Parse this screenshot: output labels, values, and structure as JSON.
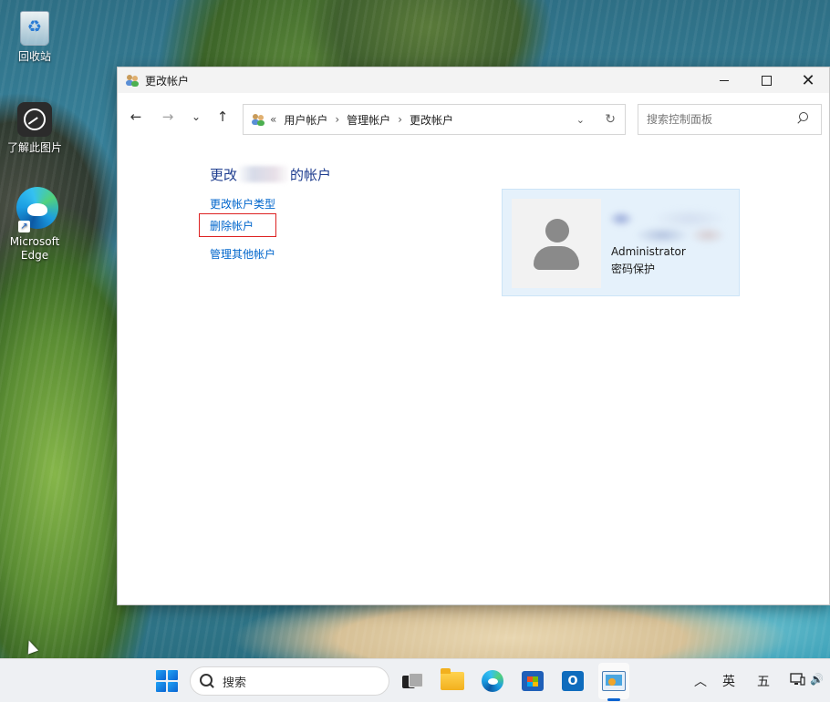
{
  "desktop": {
    "icons": [
      {
        "label": "回收站",
        "icon": "recycle-bin-icon"
      },
      {
        "label": "了解此图片",
        "icon": "learn-about-picture-icon"
      },
      {
        "label": "Microsoft Edge",
        "icon": "edge-icon"
      }
    ]
  },
  "window": {
    "title": "更改帐户",
    "controls": {
      "minimize": "minimize-icon",
      "maximize": "maximize-icon",
      "close": "close-icon",
      "close_glyph": "✕"
    },
    "nav": {
      "back": "←",
      "forward": "→",
      "recent": "⌄",
      "up": "↑"
    },
    "address": {
      "prefix": "«",
      "crumbs": [
        "用户帐户",
        "管理帐户",
        "更改帐户"
      ],
      "separator": "›",
      "dropdown": "⌄",
      "refresh": "↻"
    },
    "search": {
      "placeholder": "搜索控制面板"
    },
    "page_title_prefix": "更改",
    "page_title_suffix": "的帐户",
    "tasks": [
      "更改帐户类型",
      "删除帐户",
      "管理其他帐户"
    ],
    "account": {
      "type": "Administrator",
      "status": "密码保护"
    }
  },
  "taskbar": {
    "search_label": "搜索",
    "tray": {
      "chevron": "︿",
      "ime_lang": "英",
      "ime_mode": "五",
      "volume": "🔊"
    }
  },
  "colors": {
    "link": "#0066cc",
    "title": "#1e3d8f",
    "highlight_border": "#dd2222",
    "card_bg": "#e5f1fb",
    "accent": "#0a63d1"
  }
}
